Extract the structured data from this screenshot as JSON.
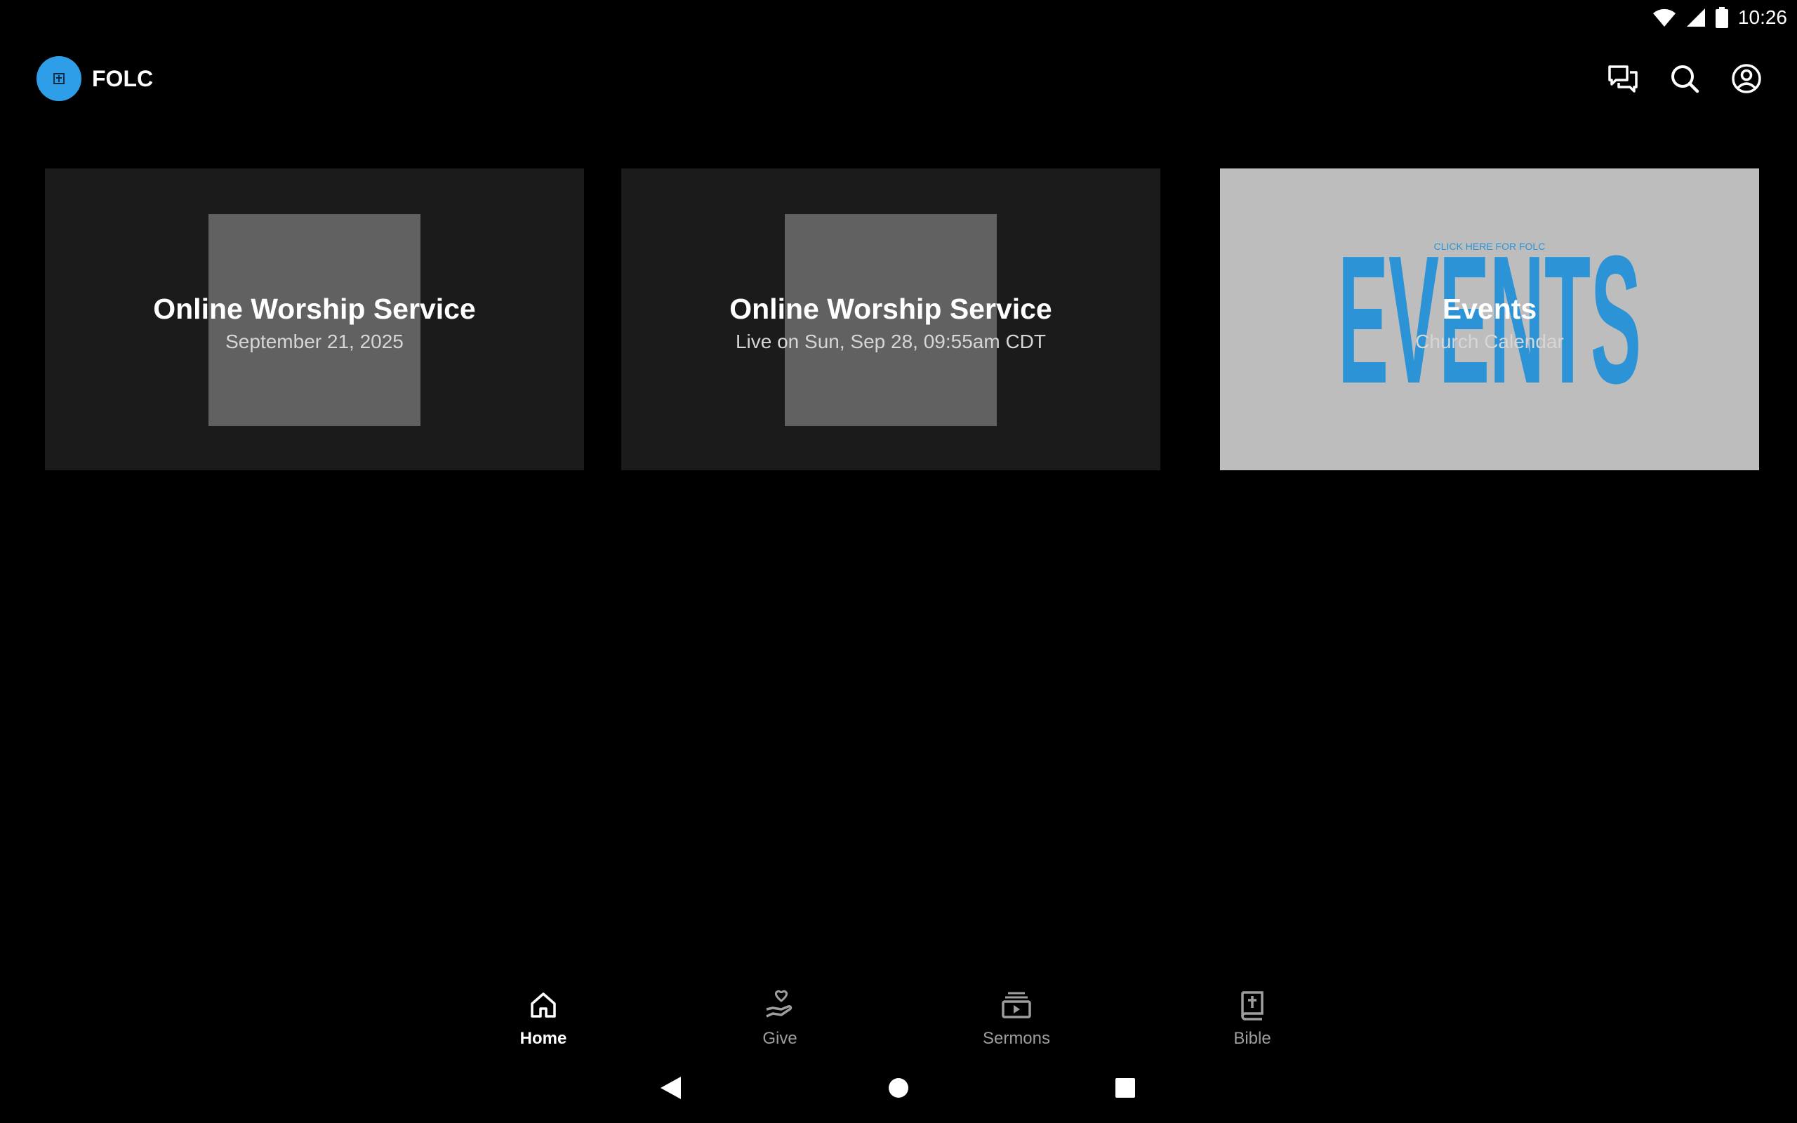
{
  "status_bar": {
    "time": "10:26",
    "icons": [
      "wifi-icon",
      "signal-icon",
      "battery-icon"
    ]
  },
  "app_bar": {
    "title": "FOLC",
    "logo_icon": "church-logo-icon",
    "actions": [
      "messages-icon",
      "search-icon",
      "account-icon"
    ]
  },
  "cards": [
    {
      "title": "Online Worship Service",
      "subtitle": "September 21, 2025"
    },
    {
      "title": "Online Worship Service",
      "subtitle": "Live on Sun, Sep 28, 09:55am CDT"
    },
    {
      "title": "Events",
      "subtitle": "Church Calendar",
      "art_top_text": "CLICK HERE FOR FOLC",
      "art_big_text": "EVENTS"
    }
  ],
  "bottom_nav": {
    "items": [
      {
        "label": "Home",
        "icon": "home-icon",
        "active": true
      },
      {
        "label": "Give",
        "icon": "give-icon",
        "active": false
      },
      {
        "label": "Sermons",
        "icon": "sermons-icon",
        "active": false
      },
      {
        "label": "Bible",
        "icon": "bible-icon",
        "active": false
      }
    ]
  },
  "colors": {
    "background": "#000000",
    "card_bg": "#1b1b1b",
    "thumb": "#616161",
    "accent": "#2f9ee8",
    "events_bg": "#bdbdbd",
    "events_text": "#2b93d6"
  }
}
